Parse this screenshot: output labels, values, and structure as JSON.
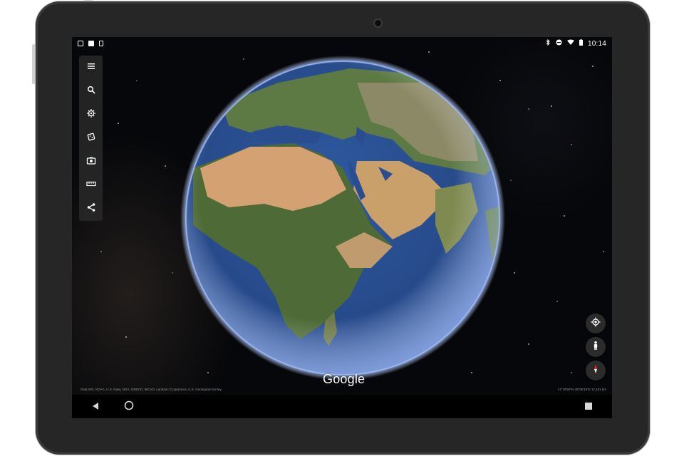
{
  "status_bar": {
    "time": "10:14",
    "left_icons": [
      "gallery-icon",
      "image-icon",
      "sim-icon"
    ],
    "right_icons": [
      "bluetooth-icon",
      "do-not-disturb-icon",
      "wifi-icon",
      "battery-icon"
    ]
  },
  "toolbar": {
    "items": [
      {
        "name": "menu",
        "icon": "menu-icon"
      },
      {
        "name": "search",
        "icon": "search-icon"
      },
      {
        "name": "voyager",
        "icon": "voyager-wheel-icon"
      },
      {
        "name": "feeling-lucky",
        "icon": "dice-icon"
      },
      {
        "name": "snapshot",
        "icon": "camera-icon"
      },
      {
        "name": "measure",
        "icon": "ruler-icon"
      },
      {
        "name": "share",
        "icon": "share-icon"
      }
    ]
  },
  "map": {
    "logo": "Google",
    "attribution": "Data SIO, NOAA, U.S. Navy, NGA, GEBCO, IBCAO, Landsat / Copernicus, U.S. Geological Survey",
    "coordinates": "17°19'50\"N 46°05'25\"E 17,181 km"
  },
  "controls": [
    {
      "name": "my-location",
      "icon": "target-icon"
    },
    {
      "name": "pegman",
      "icon": "pegman-icon"
    },
    {
      "name": "compass",
      "icon": "compass-icon"
    }
  ],
  "colors": {
    "toolbar_bg": "#282828",
    "ocean": "#2a4d8f",
    "atmosphere": "#8fb2ff",
    "compass_red": "#e0332b"
  }
}
